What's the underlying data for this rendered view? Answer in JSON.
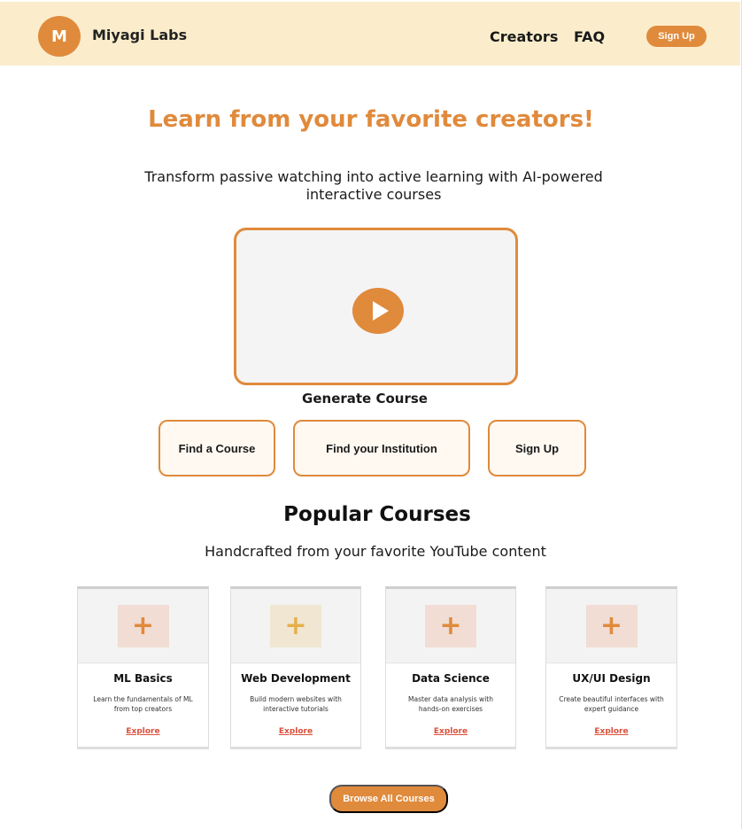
{
  "header": {
    "logo_letter": "M",
    "brand": "Miyagi Labs",
    "nav": [
      "Creators",
      "FAQ"
    ],
    "signup_label": "Sign Up"
  },
  "hero": {
    "title": "Learn from your favorite creators!",
    "subtitle": "Transform passive watching into active learning with AI-powered interactive courses",
    "generate_label": "Generate Course"
  },
  "actions": [
    "Find a Course",
    "Find your Institution",
    "Sign Up"
  ],
  "popular": {
    "title": "Popular Courses",
    "subtitle": "Handcrafted from your favorite YouTube content",
    "cards": [
      {
        "title": "ML Basics",
        "desc": "Learn the fundamentals of ML from top creators",
        "link": "Explore",
        "icon": "+"
      },
      {
        "title": "Web Development",
        "desc": "Build modern websites with interactive tutorials",
        "link": "Explore",
        "icon": "+"
      },
      {
        "title": "Data Science",
        "desc": "Master data analysis with hands-on exercises",
        "link": "Explore",
        "icon": "+"
      },
      {
        "title": "UX/UI Design",
        "desc": "Create beautiful interfaces with expert guidance",
        "link": "Explore",
        "icon": "+"
      }
    ]
  },
  "browse_label": "Browse All Courses",
  "colors": {
    "accent": "#e08a3c",
    "header_bg": "#fbedcc",
    "link_red": "#d94f3a"
  }
}
